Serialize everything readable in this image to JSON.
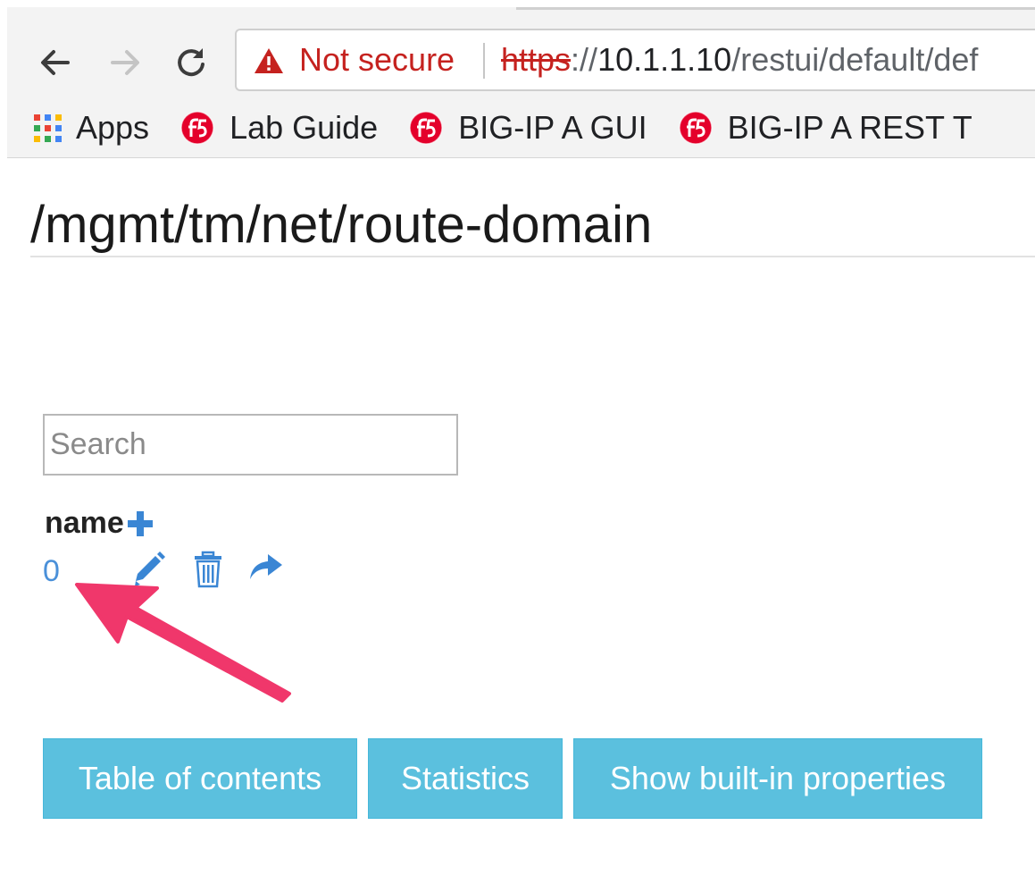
{
  "browser": {
    "security_label": "Not secure",
    "url_scheme": "https",
    "url_separator": "://",
    "url_host": "10.1.1.10",
    "url_path": "/restui/default/def",
    "bookmarks": [
      {
        "label": "Apps",
        "icon": "apps-grid-icon"
      },
      {
        "label": "Lab Guide",
        "icon": "f5-logo-icon"
      },
      {
        "label": "BIG-IP A GUI",
        "icon": "f5-logo-icon"
      },
      {
        "label": "BIG-IP A REST T",
        "icon": "f5-logo-icon"
      }
    ]
  },
  "page": {
    "title": "/mgmt/tm/net/route-domain"
  },
  "search": {
    "placeholder": "Search",
    "value": ""
  },
  "table": {
    "column_header": "name",
    "rows": [
      {
        "name": "0"
      }
    ]
  },
  "buttons": {
    "toc": "Table of contents",
    "statistics": "Statistics",
    "builtin": "Show built-in properties"
  },
  "colors": {
    "accent_button": "#5bc0de",
    "link": "#4a90d9",
    "icon_blue": "#3a86d4",
    "annotation_arrow": "#f0376b",
    "warning_red": "#c5221f"
  }
}
